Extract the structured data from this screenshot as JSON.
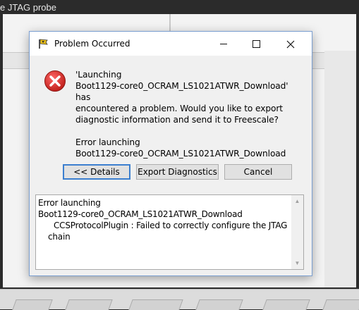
{
  "background": {
    "window_title_fragment": "e JTAG probe"
  },
  "dialog": {
    "title": "Problem Occurred",
    "window_controls": {
      "minimize": "minimize",
      "maximize": "maximize",
      "close": "close"
    },
    "icon": "error-icon",
    "message": {
      "line1": "'Launching",
      "line2": "Boot1129-core0_OCRAM_LS1021ATWR_Download' has",
      "line3": "encountered a problem. Would you like to export",
      "line4": "diagnostic information and send it to Freescale?",
      "line5": "Error launching",
      "line6": "Boot1129-core0_OCRAM_LS1021ATWR_Download"
    },
    "buttons": {
      "details": "<< Details",
      "export": "Export Diagnostics",
      "cancel": "Cancel"
    },
    "details": {
      "line1": "Error launching",
      "line2": "Boot1129-core0_OCRAM_LS1021ATWR_Download",
      "line3": "CCSProtocolPlugin : Failed to correctly configure the JTAG",
      "line4": "chain"
    }
  },
  "colors": {
    "error_red": "#e0352b",
    "focus_blue": "#3c7fcf"
  }
}
